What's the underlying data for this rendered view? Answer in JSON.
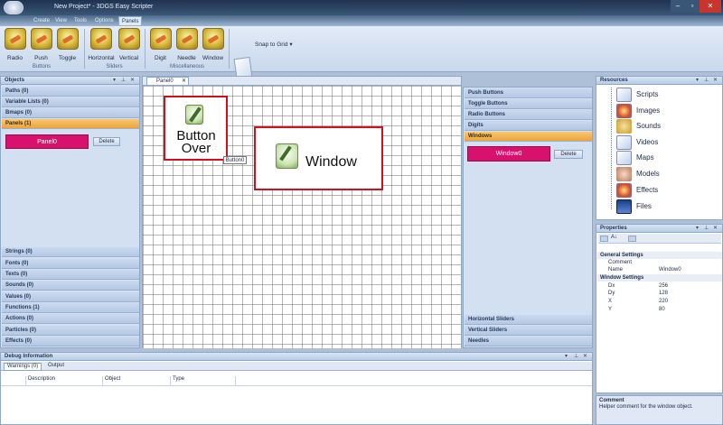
{
  "window": {
    "title": "New Project* - 3DGS Easy Scripter",
    "min": "–",
    "max": "▫",
    "close": "✕"
  },
  "menu": [
    "Create",
    "View",
    "Tools",
    "Options",
    "Panels"
  ],
  "ribbon": {
    "buttons": [
      "Radio",
      "Push",
      "Toggle",
      "Horizontal",
      "Vertical",
      "Digit",
      "Needle",
      "Window"
    ],
    "groups": [
      "Buttons",
      "Sliders",
      "Miscellaneous"
    ],
    "snap_label": "Snap to Grid",
    "snap_caret": "▾"
  },
  "objects": {
    "title": "Objects",
    "categories_top": [
      "Paths (0)",
      "Variable Lists (0)",
      "Bmaps (0)",
      "Panels (1)"
    ],
    "item_name": "Panel0",
    "delete_label": "Delete",
    "categories_bottom": [
      "Strings (0)",
      "Fonts (0)",
      "Texts (0)",
      "Sounds (0)",
      "Values (0)",
      "Functions (1)",
      "Actions (0)",
      "Particles (0)",
      "Effects (0)"
    ]
  },
  "document": {
    "tab": "Panel0",
    "widget_button_l1": "Button",
    "widget_button_l2": "Over",
    "tooltip": "Button0",
    "widget_window": "Window"
  },
  "palette": {
    "top": [
      "Push Buttons",
      "Toggle Buttons",
      "Radio Buttons",
      "Digits",
      "Windows"
    ],
    "item_name": "Window0",
    "delete_label": "Delete",
    "bottom": [
      "Horizontal Sliders",
      "Vertical Sliders",
      "Needles"
    ]
  },
  "resources": {
    "title": "Resources",
    "items": [
      "Scripts",
      "Images",
      "Sounds",
      "Videos",
      "Maps",
      "Models",
      "Effects",
      "Files"
    ]
  },
  "properties": {
    "title": "Properties",
    "rows": [
      {
        "k": "General Settings",
        "v": "",
        "sec": true
      },
      {
        "k": "Comment",
        "v": "",
        "sec": false
      },
      {
        "k": "Name",
        "v": "Window0",
        "sec": false
      },
      {
        "k": "Window Settings",
        "v": "",
        "sec": true
      },
      {
        "k": "Dx",
        "v": "256",
        "sec": false
      },
      {
        "k": "Dy",
        "v": "128",
        "sec": false
      },
      {
        "k": "X",
        "v": "220",
        "sec": false
      },
      {
        "k": "Y",
        "v": "80",
        "sec": false
      }
    ]
  },
  "comment": {
    "title": "Comment",
    "text": "Helper comment for the window object."
  },
  "debug": {
    "title": "Debug Information",
    "tabs": [
      "Warnings (0)",
      "Output"
    ],
    "columns": [
      "Description",
      "Object",
      "Type"
    ]
  },
  "colors": {
    "accent_orange": "#eca43b",
    "widget_pink": "#d8106e",
    "widget_border": "#d0101d"
  }
}
